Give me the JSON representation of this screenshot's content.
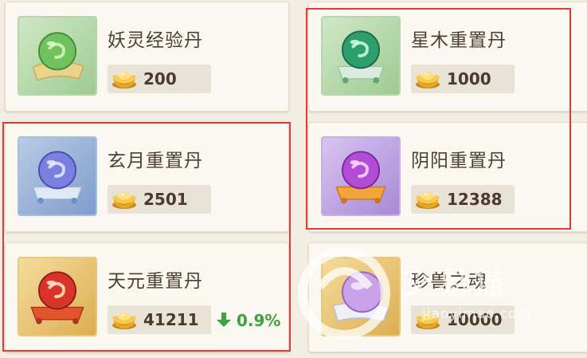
{
  "items": [
    {
      "name": "妖灵经验丹",
      "price": "200"
    },
    {
      "name": "星木重置丹",
      "price": "1000"
    },
    {
      "name": "玄月重置丹",
      "price": "2501"
    },
    {
      "name": "阴阳重置丹",
      "price": "12388"
    },
    {
      "name": "天元重置丹",
      "price": "41211",
      "trend": "0.9%"
    },
    {
      "name": "珍兽之魂",
      "price": "10000"
    }
  ],
  "watermark": {
    "brand": "交易猫",
    "url": "jiaoyimao.com"
  },
  "colors": {
    "highlight": "#e23b33",
    "trend_up": "#3ea23e",
    "card_bg": "#fbf8f2"
  }
}
